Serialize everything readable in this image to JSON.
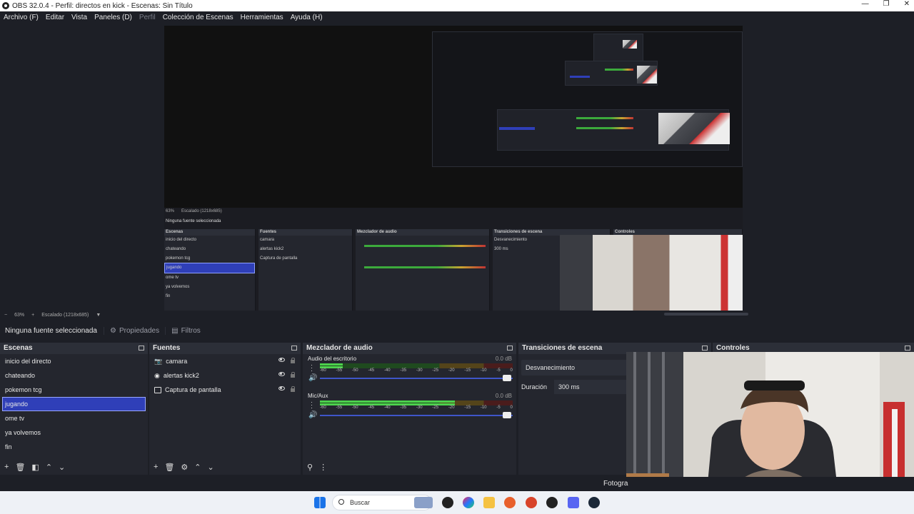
{
  "window": {
    "title": "OBS 32.0.4 - Perfil: directos en kick - Escenas: Sin Título",
    "minimize": "—",
    "maximize": "❐",
    "close": "✕"
  },
  "menu": {
    "items": [
      "Archivo (F)",
      "Editar",
      "Vista",
      "Paneles (D)",
      "Perfil",
      "Colección de Escenas",
      "Herramientas",
      "Ayuda (H)"
    ]
  },
  "preview": {
    "zoom": "63%",
    "scaling": "Escalado (1218x685)",
    "nested_no_source": "Ninguna fuente seleccionada",
    "nested_zoom": "63%",
    "nested_scaling": "Escalado (1218x685)"
  },
  "source_toolbar": {
    "no_source": "Ninguna fuente seleccionada",
    "properties": "Propiedades",
    "filters": "Filtros"
  },
  "scenes": {
    "title": "Escenas",
    "items": [
      "inicio del directo",
      "chateando",
      "pokemon tcg",
      "jugando",
      "ome tv",
      "ya volvemos",
      "fin"
    ],
    "selected": "jugando"
  },
  "sources": {
    "title": "Fuentes",
    "items": [
      {
        "label": "camara",
        "icon": "camera-icon"
      },
      {
        "label": "alertas kick2",
        "icon": "browser-icon"
      },
      {
        "label": "Captura de pantalla",
        "icon": "display-icon"
      }
    ]
  },
  "mixer": {
    "title": "Mezclador de audio",
    "channels": [
      {
        "name": "Audio del escritorio",
        "db": "0.0 dB",
        "level": 0.12
      },
      {
        "name": "Mic/Aux",
        "db": "0.0 dB",
        "level": 0.7
      }
    ],
    "ticks": [
      "-60",
      "-55",
      "-50",
      "-45",
      "-40",
      "-35",
      "-30",
      "-25",
      "-20",
      "-15",
      "-10",
      "-5",
      "0"
    ]
  },
  "transitions": {
    "title": "Transiciones de escena",
    "selected": "Desvanecimiento",
    "duration_label": "Duración",
    "duration_value": "300 ms"
  },
  "controls": {
    "title": "Controles"
  },
  "status": {
    "fragment": "Fotogra"
  },
  "taskbar": {
    "search": "Buscar"
  },
  "colors": {
    "background": "#1d1f26",
    "panel": "#24262e",
    "selection": "#2f3fb8",
    "meter_green": "#4cd14c"
  }
}
